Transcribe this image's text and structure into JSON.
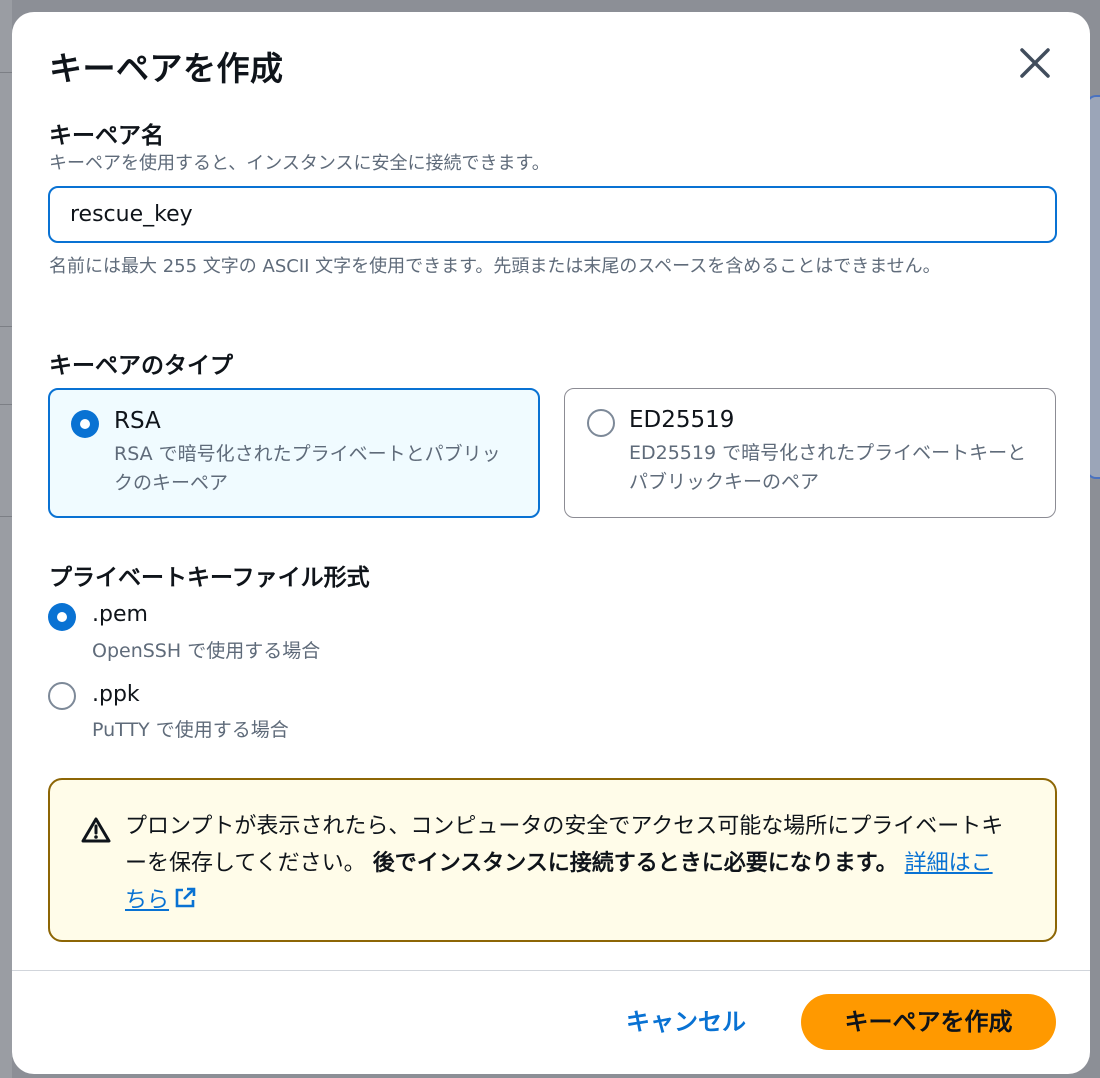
{
  "dialog": {
    "title": "キーペアを作成",
    "close_icon": "close-icon"
  },
  "key_name": {
    "label": "キーペア名",
    "description": "キーペアを使用すると、インスタンスに安全に接続できます。",
    "value": "rescue_key",
    "hint": "名前には最大 255 文字の ASCII 文字を使用できます。先頭または末尾のスペースを含めることはできません。"
  },
  "key_type": {
    "label": "キーペアのタイプ",
    "options": [
      {
        "title": "RSA",
        "description": "RSA で暗号化されたプライベートとパブリックのキーペア",
        "selected": true
      },
      {
        "title": "ED25519",
        "description": "ED25519 で暗号化されたプライベートキーとパブリックキーのペア",
        "selected": false
      }
    ]
  },
  "file_format": {
    "label": "プライベートキーファイル形式",
    "options": [
      {
        "title": ".pem",
        "description": "OpenSSH で使用する場合",
        "selected": true
      },
      {
        "title": ".ppk",
        "description": "PuTTY で使用する場合",
        "selected": false
      }
    ]
  },
  "warning": {
    "icon": "warning-icon",
    "text": "プロンプトが表示されたら、コンピュータの安全でアクセス可能な場所にプライベートキーを保存してください。",
    "bold_text": "後でインスタンスに接続するときに必要になります。",
    "link_label": "詳細はこちら",
    "link_icon": "external-link-icon",
    "color": "#8d6605"
  },
  "footer": {
    "cancel_label": "キャンセル",
    "create_label": "キーペアを作成"
  },
  "colors": {
    "accent": "#0972d3",
    "primary_button": "#ff9900"
  }
}
